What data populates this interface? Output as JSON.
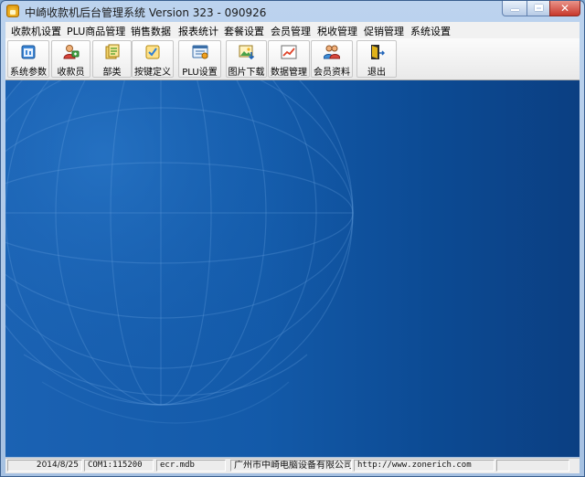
{
  "window": {
    "title": "中崎收款机后台管理系统    Version 323 - 090926",
    "close_glyph": "✕"
  },
  "menu": [
    "收款机设置",
    "PLU商品管理",
    "销售数据",
    "报表统计",
    "套餐设置",
    "会员管理",
    "税收管理",
    "促销管理",
    "系统设置"
  ],
  "toolbar": [
    {
      "label": "系统参数",
      "icon": "settings-icon"
    },
    {
      "label": "收款员",
      "icon": "cashier-icon"
    },
    {
      "label": "部类",
      "icon": "category-icon"
    },
    {
      "label": "按键定义",
      "icon": "key-define-icon"
    },
    {
      "label": "PLU设置",
      "icon": "plu-settings-icon"
    },
    {
      "label": "图片下载",
      "icon": "image-download-icon"
    },
    {
      "label": "数据管理",
      "icon": "chart-icon"
    },
    {
      "label": "会员资料",
      "icon": "members-icon"
    },
    {
      "label": "退出",
      "icon": "exit-door-icon"
    }
  ],
  "status": {
    "date": "2014/8/25",
    "port": "COM1:115200",
    "db": "ecr.mdb",
    "company": "广州市中崎电脑设备有限公司",
    "url": "http://www.zonerich.com"
  },
  "colors": {
    "background_blue": "#135aa9",
    "titlebar": "#bcd3ee",
    "close_button": "#c8372b"
  }
}
